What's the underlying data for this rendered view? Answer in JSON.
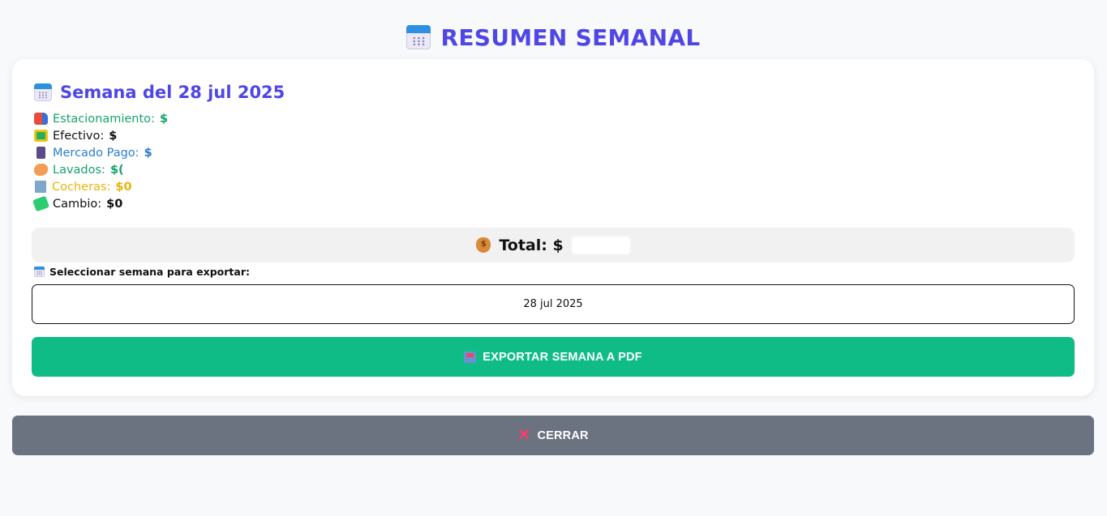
{
  "page_title": "RESUMEN SEMANAL",
  "week": {
    "heading": "Semana del 28 jul 2025",
    "lines": [
      {
        "label": "Estacionamiento:",
        "value": "$",
        "icon": "truck-icon"
      },
      {
        "label": "Efectivo:",
        "value": "$",
        "icon": "cash-icon"
      },
      {
        "label": "Mercado Pago:",
        "value": "$",
        "icon": "phone-icon"
      },
      {
        "label": "Lavados:",
        "value": "$(",
        "icon": "sponge-icon"
      },
      {
        "label": "Cocheras:",
        "value": "$0",
        "icon": "building-icon"
      },
      {
        "label": "Cambio:",
        "value": "$0",
        "icon": "money-icon"
      }
    ]
  },
  "total": {
    "label": "Total: $",
    "icon": "money-bag-icon"
  },
  "export": {
    "select_label": "Seleccionar semana para exportar:",
    "selected_week": "28 jul 2025",
    "button_label": "EXPORTAR SEMANA A PDF",
    "button_icon": "inbox-icon"
  },
  "close": {
    "button_label": "CERRAR",
    "icon": "close-icon"
  },
  "colors": {
    "accent": "#4f46e5",
    "green": "#16a36a",
    "blue": "#2a7fc9",
    "yellow": "#eab308",
    "export_button": "#10bc86",
    "close_button": "#6b7280"
  }
}
